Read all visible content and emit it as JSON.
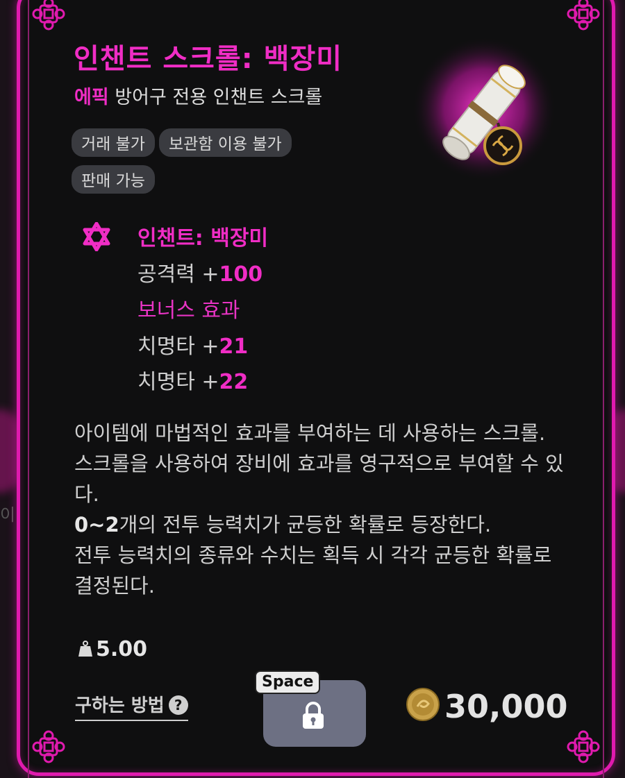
{
  "item": {
    "name": "인챈트 스크롤: 백장미",
    "rarity": "에픽",
    "type": "방어구 전용 인챈트 스크롤",
    "tags": [
      "거래 불가",
      "보관함 이용 불가",
      "판매 가능"
    ],
    "icon": "scroll-icon"
  },
  "enchant": {
    "title": "인챈트: 백장미",
    "icon": "hexagram-star-icon",
    "base_stat": {
      "label": "공격력 +",
      "value": "100"
    },
    "bonus_title": "보너스 효과",
    "bonus_stats": [
      {
        "label": "치명타 +",
        "value": "21"
      },
      {
        "label": "치명타 +",
        "value": "22"
      }
    ]
  },
  "description": {
    "line1": "아이템에 마법적인 효과를 부여하는 데 사용하는 스크롤.",
    "line2": "스크롤을 사용하여 장비에 효과를 영구적으로 부여할 수 있다.",
    "line3_bold": "0~2",
    "line3_rest": "개의 전투 능력치가 균등한 확률로 등장한다.",
    "line4": "전투 능력치의 종류와 수치는 획득 시 각각 균등한 확률로 결정된다."
  },
  "weight": {
    "icon": "weight-icon",
    "value": "5.00"
  },
  "footer": {
    "howto_label": "구하는 방법",
    "help_glyph": "?",
    "hotkey": "Space",
    "lock_icon": "lock-icon",
    "price": "30,000",
    "coin_icon": "gold-coin-icon"
  },
  "background": {
    "partial_text": "이"
  },
  "colors": {
    "accent": "#f02dc5",
    "frame": "#e01aae",
    "tag_bg": "#3a3b40",
    "button_bg": "#6d7083"
  }
}
